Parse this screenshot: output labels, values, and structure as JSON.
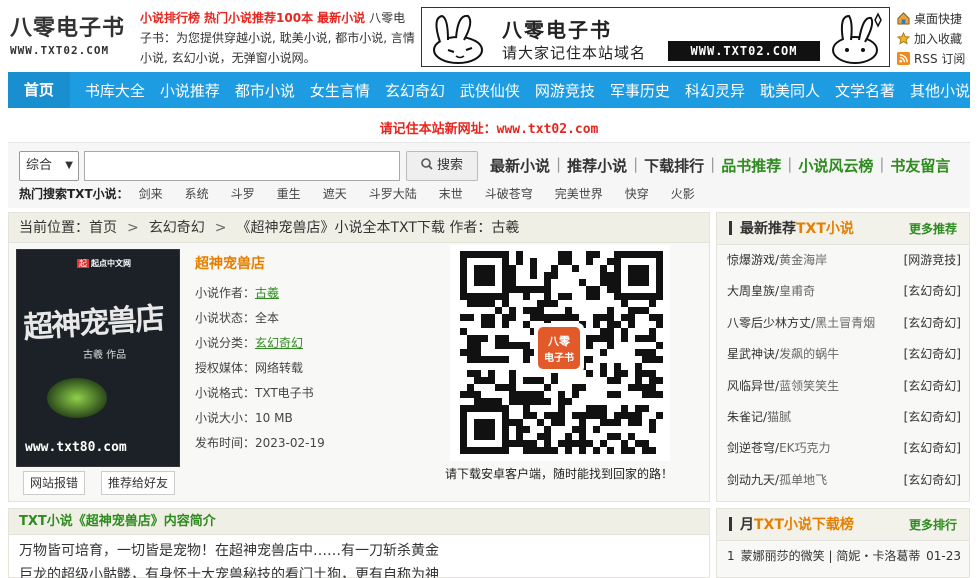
{
  "site": {
    "logo_cn": "八零电子书",
    "logo_en": "WWW.TXT02.COM",
    "intro_links": [
      "小说排行榜",
      "热门小说推荐100本",
      "最新小说"
    ],
    "intro_text": "八零电子书：为您提供穿越小说, 耽美小说, 都市小说, 言情小说, 玄幻小说，无弹窗小说网。"
  },
  "banner": {
    "title": "八零电子书",
    "subtitle": "请大家记住本站域名",
    "url": "WWW.TXT02.COM"
  },
  "quick": [
    {
      "label": "桌面快捷",
      "icon": "home-icon"
    },
    {
      "label": "加入收藏",
      "icon": "star-icon"
    },
    {
      "label": "RSS 订阅",
      "icon": "rss-icon"
    }
  ],
  "nav": {
    "home": "首页",
    "items": [
      "书库大全",
      "小说推荐",
      "都市小说",
      "女生言情",
      "玄幻奇幻",
      "武侠仙侠",
      "网游竞技",
      "军事历史",
      "科幻灵异",
      "耽美同人",
      "文学名著",
      "其他小说"
    ]
  },
  "notice": {
    "text": "请记住本站新网址：",
    "url": "www.txt02.com"
  },
  "search": {
    "select_value": "综合",
    "button": "搜索",
    "placeholder": "",
    "links": [
      {
        "label": "最新小说",
        "green": false
      },
      {
        "label": "推荐小说",
        "green": false
      },
      {
        "label": "下载排行",
        "green": false
      },
      {
        "label": "品书推荐",
        "green": true
      },
      {
        "label": "小说风云榜",
        "green": true
      },
      {
        "label": "书友留言",
        "green": true
      }
    ],
    "hot_label": "热门搜索TXT小说：",
    "hot": [
      "剑来",
      "系统",
      "斗罗",
      "重生",
      "遮天",
      "斗罗大陆",
      "末世",
      "斗破苍穹",
      "完美世界",
      "快穿",
      "火影"
    ]
  },
  "breadcrumb": {
    "prefix": "当前位置：",
    "home": "首页",
    "category": "玄幻奇幻",
    "current": "《超神宠兽店》小说全本TXT下载 作者：古羲"
  },
  "cover": {
    "title": "超神宠兽店",
    "author": "古羲  作品",
    "publisher": "起点中文网",
    "watermark": "www.txt80.com"
  },
  "book": {
    "title": "超神宠兽店",
    "rows": [
      {
        "label": "小说作者：",
        "value": "古羲",
        "link": true
      },
      {
        "label": "小说状态：",
        "value": "全本",
        "link": false
      },
      {
        "label": "小说分类：",
        "value": "玄幻奇幻",
        "link": true
      },
      {
        "label": "授权媒体：",
        "value": "网络转载",
        "link": false
      },
      {
        "label": "小说格式：",
        "value": "TXT电子书",
        "link": false
      },
      {
        "label": "小说大小：",
        "value": "10 MB",
        "link": false
      },
      {
        "label": "发布时间：",
        "value": "2023-02-19",
        "link": false
      }
    ],
    "report_button": "网站报错",
    "recommend_button": "推荐给好友"
  },
  "qr": {
    "center_text": "八零电子书",
    "caption": "请下载安卓客户端，随时能找到回家的路！"
  },
  "summary": {
    "title": "TXT小说《超神宠兽店》内容简介",
    "text": "万物皆可培育，一切皆是宠物！在超神宠兽店中……有一刀斩杀黄金巨龙的超级小骷髅，有身怀十大宠兽秘技的看门土狗，更有自称为神"
  },
  "sidebar": {
    "head_prefix": "最新推荐",
    "head_orange": "TXT小说",
    "more": "更多推荐",
    "items": [
      {
        "title": "惊爆游戏",
        "author": "黄金海岸",
        "cat": "[网游竞技]"
      },
      {
        "title": "大周皇族",
        "author": "皇甫奇",
        "cat": "[玄幻奇幻]"
      },
      {
        "title": "八零后少林方丈",
        "author": "黑土冒青烟",
        "cat": "[玄幻奇幻]"
      },
      {
        "title": "星武神诀",
        "author": "发飙的蜗牛",
        "cat": "[玄幻奇幻]"
      },
      {
        "title": "风临异世",
        "author": "蓝领笑笑生",
        "cat": "[玄幻奇幻]"
      },
      {
        "title": "朱雀记",
        "author": "猫腻",
        "cat": "[玄幻奇幻]"
      },
      {
        "title": "剑逆苍穹",
        "author": "EK巧克力",
        "cat": "[玄幻奇幻]"
      },
      {
        "title": "剑动九天",
        "author": "孤单地飞",
        "cat": "[玄幻奇幻]"
      }
    ]
  },
  "ranking": {
    "head_prefix": "月",
    "head_orange": "TXT小说下载榜",
    "more": "更多排行",
    "items": [
      {
        "n": "1",
        "title": "蒙娜丽莎的微笑",
        "author": "简妮・卡洛葛蒂",
        "date": "01-23"
      }
    ]
  }
}
